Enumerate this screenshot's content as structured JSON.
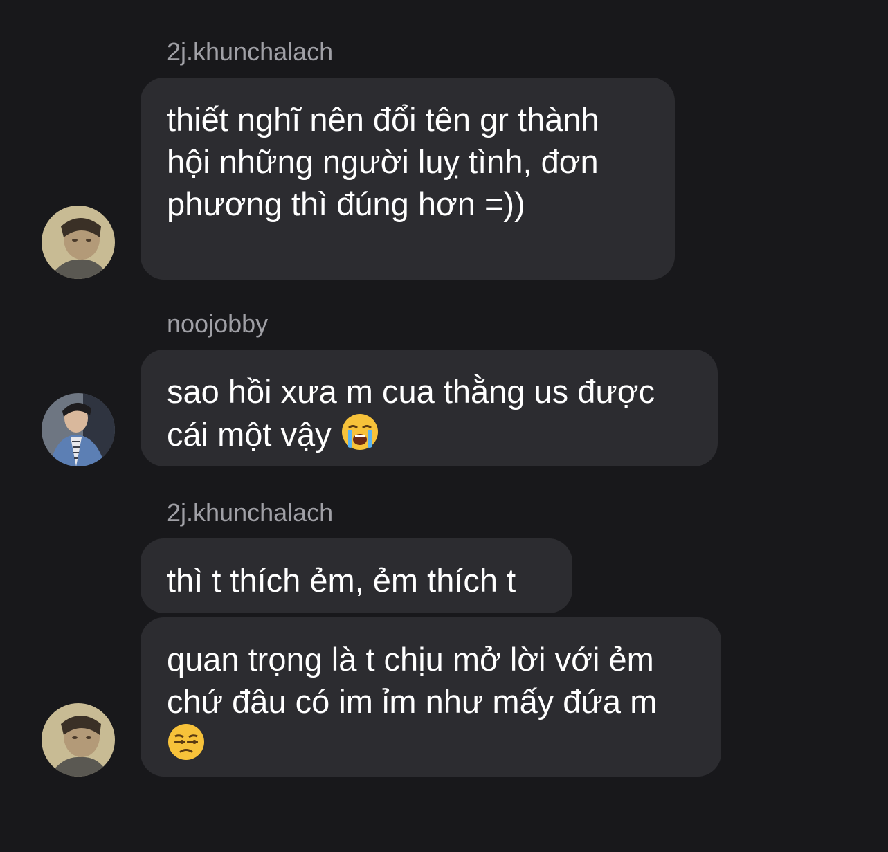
{
  "messages": [
    {
      "username": "2j.khunchalach",
      "lines": [
        "thiết nghĩ nên đổi tên gr thành",
        "hội những người luỵ tình, đơn",
        "phương thì đúng hơn =))"
      ]
    },
    {
      "username": "noojobby",
      "lines": [
        "sao hồi xưa m cua thằng us được",
        "cái một vậy"
      ],
      "emoji": "loudly-crying-face"
    },
    {
      "username": "2j.khunchalach",
      "lines": [
        "thì t thích ẻm, ẻm thích t"
      ]
    },
    {
      "lines": [
        "quan trọng là t chịu mở lời với ẻm",
        "chứ đâu có im ỉm như mấy đứa m"
      ],
      "emoji": "unamused-face"
    }
  ],
  "colors": {
    "background": "#18181b",
    "bubble": "#2c2c30",
    "username": "#a0a0a6",
    "text": "#ffffff"
  }
}
